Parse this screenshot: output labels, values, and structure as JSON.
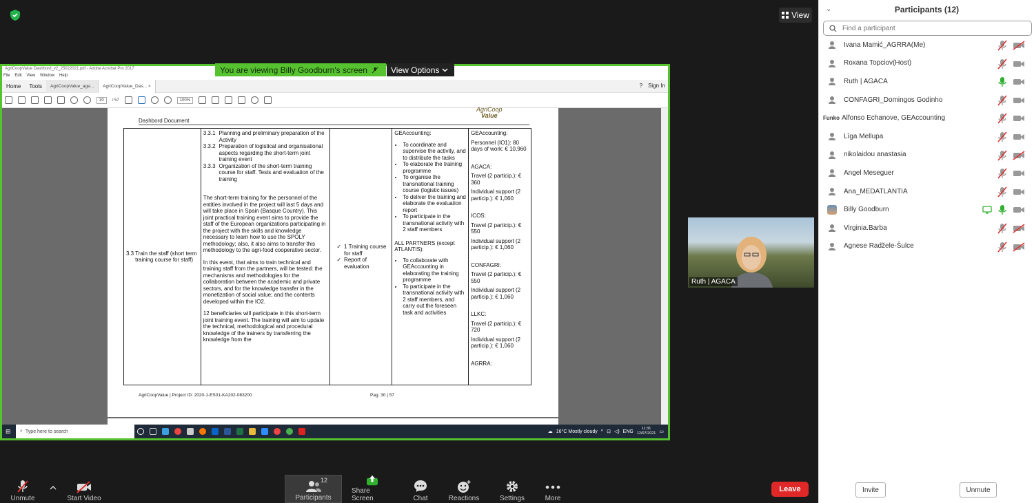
{
  "view_button": "View",
  "banner": {
    "text": "You are viewing Billy Goodburn's screen",
    "options": "View Options"
  },
  "acrobat": {
    "title": "AgriCoopValue Dashbord_v2_25022021.pdf - Adobe Acrobat Pro 2017",
    "menu": [
      "File",
      "Edit",
      "View",
      "Window",
      "Help"
    ],
    "tabs": [
      "Home",
      "Tools",
      "AgriCoopValue_age...",
      "AgriCoopValue_Das..."
    ],
    "sign_in": "Sign In",
    "page_current": "30",
    "page_total": "/ 57",
    "zoom": "100%"
  },
  "doc": {
    "header": "Dashbord Document",
    "logo_top": "AgriCoop",
    "logo_bottom": "Value",
    "row_id": "3.3",
    "activity": "Train the staff (short term training course for staff)",
    "tasks": [
      {
        "num": "3.3.1",
        "text": "Planning and preliminary preparation of the Activity"
      },
      {
        "num": "3.3.2",
        "text": "Preparation of logistical and organisational aspects regarding the short-term joint training event"
      },
      {
        "num": "3.3.3",
        "text": "Organization of the short-term training course for staff. Tests and evaluation of the training"
      }
    ],
    "para1": "The short-term training for the personnel of the entities involved in the project will last 5 days and will take place in Spain (Basque Country). This joint practical training event aims to provide the staff of the European organizations participating in the project with the skills and knowledge necessary to learn how to use the SPOLY methodology; also, it also aims to transfer this methodology to the agri-food cooperative sector.",
    "para2": "In this event, that aims to train technical and training staff from the partners, will be tested: the mechanisms and methodologies for the collaboration between the academic and private sectors, and for the knowledge transfer in the monetization of social value; and the contents developed within the IO2.",
    "para3": "12 beneficiaries will participate in this short-term joint training event. The training will aim to update the technical, methodological and procedural knowledge of the trainers by transferring the knowledge from the",
    "outputs": [
      "1 Training course for staff",
      "Report of evaluation"
    ],
    "resp_head": "GEAccounting:",
    "resp_items": [
      "To coordinate and supervise the activity, and to distribute the tasks",
      "To elaborate the training programme",
      "To organise the transnational training course (logistic issues)",
      "To deliver the training and elaborate the evaluation report",
      "To participate in the transnational activity with 2 staff members"
    ],
    "resp_head2": "ALL PARTNERS (except ATLANTIS):",
    "resp_items2": [
      "To collaborate with GEAccounting in elaborating the training programme",
      "To participate in the transnational activity with 2 staff members, and carry out the foreseen task and activities"
    ],
    "budget": [
      {
        "org": "GEAccounting:",
        "lines": [
          "Personnel (IO1): 80 days of work: € 10,960"
        ]
      },
      {
        "org": "AGACA:",
        "lines": [
          "Travel (2 particip.): € 360",
          "Individual support (2 particip.): € 1,060"
        ]
      },
      {
        "org": "ICOS:",
        "lines": [
          "Travel (2 particip.): € 550",
          "Individual support (2 particip.): € 1,060"
        ]
      },
      {
        "org": "CONFAGRI:",
        "lines": [
          "Travel (2 particip.): € 550",
          "Individual support (2 particip.): € 1,060"
        ]
      },
      {
        "org": "LLKC:",
        "lines": [
          "Travel (2 particip.): € 720",
          "Individual support (2 particip.): € 1,060"
        ]
      },
      {
        "org": "AGRRA:",
        "lines": []
      }
    ],
    "footer_left": "AgriCoopValue | Project ID: 2020-1-ES01-KA202-083200",
    "footer_right": "Pag. 30 | 57"
  },
  "taskbar": {
    "search": "Type here to search",
    "weather": "16°C Mostly cloudy",
    "lang": "ENG",
    "time": "11:31",
    "date": "12/07/2021"
  },
  "video": {
    "name": "Ruth | AGACA"
  },
  "panel": {
    "title": "Participants (12)",
    "search_placeholder": "Find a participant",
    "participants": [
      {
        "name": "Ivana Mamić_AGRRA(Me)",
        "mic": "muted",
        "cam": "off"
      },
      {
        "name": "Roxana Topciov(Host)",
        "mic": "muted",
        "cam": "on"
      },
      {
        "name": "Ruth | AGACA",
        "mic": "on",
        "cam": "on"
      },
      {
        "name": "CONFAGRI_Domingos Godinho",
        "mic": "muted",
        "cam": "on"
      },
      {
        "name": "Alfonso Echanove, GEAccounting",
        "mic": "muted",
        "cam": "on",
        "avatar": "Funko"
      },
      {
        "name": "Līga Mellupa",
        "mic": "muted",
        "cam": "on"
      },
      {
        "name": "nikolaidou anastasia",
        "mic": "muted",
        "cam": "off"
      },
      {
        "name": "Angel Meseguer",
        "mic": "muted",
        "cam": "on"
      },
      {
        "name": "Ana_MEDATLANTIA",
        "mic": "muted",
        "cam": "on"
      },
      {
        "name": "Billy Goodburn",
        "mic": "on",
        "cam": "on",
        "sharing": true
      },
      {
        "name": "Virginia.Barba",
        "mic": "muted",
        "cam": "off"
      },
      {
        "name": "Agnese Radžele-Šulce",
        "mic": "muted",
        "cam": "off"
      }
    ],
    "invite": "Invite",
    "unmute_all": "Unmute"
  },
  "toolbar": {
    "unmute": "Unmute",
    "start_video": "Start Video",
    "participants": "Participants",
    "participants_count": "12",
    "share": "Share Screen",
    "chat": "Chat",
    "reactions": "Reactions",
    "settings": "Settings",
    "more": "More",
    "leave": "Leave"
  },
  "colors": {
    "green": "#56c22f",
    "red": "#e02828",
    "mute_red": "#e0312f"
  }
}
